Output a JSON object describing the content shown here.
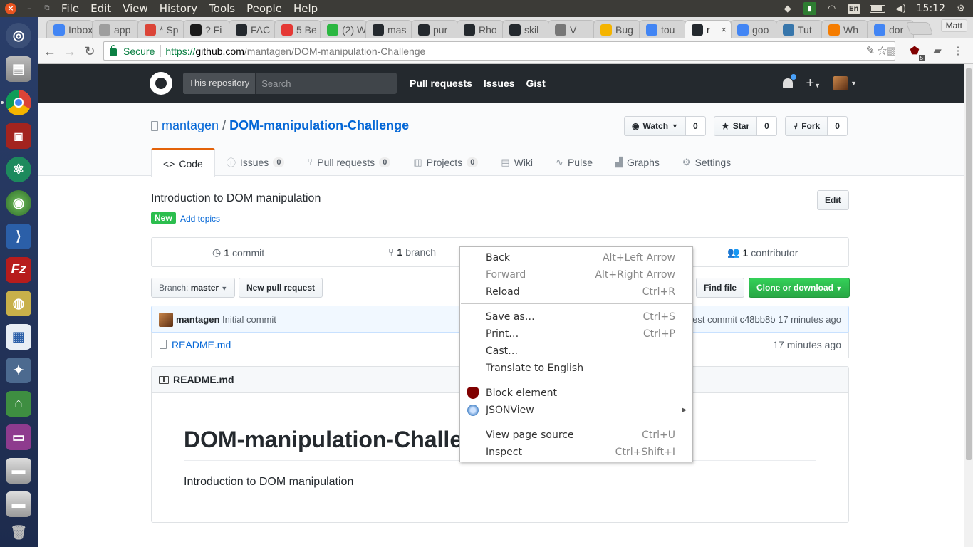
{
  "system": {
    "menus": [
      "File",
      "Edit",
      "View",
      "History",
      "Tools",
      "People",
      "Help"
    ],
    "keyboard_layout": "En",
    "clock": "15:12"
  },
  "browser": {
    "tabs": [
      {
        "title": "Inbox",
        "icon": "gmail-icon",
        "color": "#4285f4"
      },
      {
        "title": "app",
        "icon": "cloud-icon",
        "color": "#9e9e9e"
      },
      {
        "title": "* Sp",
        "icon": "sheets-icon",
        "color": "#db4437"
      },
      {
        "title": "? Fi",
        "icon": "glitch-icon",
        "color": "#1b1b1b"
      },
      {
        "title": "FAC",
        "icon": "github-icon",
        "color": "#24292e"
      },
      {
        "title": "5 Be",
        "icon": "bar-icon",
        "color": "#e53935"
      },
      {
        "title": "(2) W",
        "icon": "whatsapp-icon",
        "color": "#2bb741"
      },
      {
        "title": "mas",
        "icon": "github-icon",
        "color": "#24292e"
      },
      {
        "title": "pur",
        "icon": "github-icon",
        "color": "#24292e"
      },
      {
        "title": "Rho",
        "icon": "github-icon",
        "color": "#24292e"
      },
      {
        "title": "skil",
        "icon": "github-icon",
        "color": "#24292e"
      },
      {
        "title": "V",
        "icon": "page-icon",
        "color": "#777777"
      },
      {
        "title": "Bug",
        "icon": "lp-icon",
        "color": "#f4b400"
      },
      {
        "title": "tou",
        "icon": "google-icon",
        "color": "#4285f4"
      },
      {
        "title": "r",
        "icon": "github-icon",
        "color": "#24292e",
        "active": true
      },
      {
        "title": "goo",
        "icon": "google-icon",
        "color": "#4285f4"
      },
      {
        "title": "Tut",
        "icon": "python-icon",
        "color": "#3776ab"
      },
      {
        "title": "Wh",
        "icon": "asterisk-icon",
        "color": "#f57c00"
      },
      {
        "title": "dor",
        "icon": "google-icon",
        "color": "#4285f4"
      }
    ],
    "profile_name": "Matt",
    "security_label": "Secure",
    "url_scheme": "https://",
    "url_host": "github.com",
    "url_path": "/mantagen/DOM-manipulation-Challenge",
    "ublock_badge": "5"
  },
  "github": {
    "search_scope": "This repository",
    "search_placeholder": "Search",
    "nav": [
      "Pull requests",
      "Issues",
      "Gist"
    ],
    "owner": "mantagen",
    "repo": "DOM-manipulation-Challenge",
    "watch": {
      "label": "Watch",
      "count": "0"
    },
    "star": {
      "label": "Star",
      "count": "0"
    },
    "fork": {
      "label": "Fork",
      "count": "0"
    },
    "tabs": [
      {
        "label": "Code",
        "icon": "code-icon"
      },
      {
        "label": "Issues",
        "count": "0",
        "icon": "issue-icon"
      },
      {
        "label": "Pull requests",
        "count": "0",
        "icon": "pr-icon"
      },
      {
        "label": "Projects",
        "count": "0",
        "icon": "project-icon"
      },
      {
        "label": "Wiki",
        "icon": "wiki-icon"
      },
      {
        "label": "Pulse",
        "icon": "pulse-icon"
      },
      {
        "label": "Graphs",
        "icon": "graph-icon"
      },
      {
        "label": "Settings",
        "icon": "gear-icon"
      }
    ],
    "description": "Introduction to DOM manipulation",
    "edit_label": "Edit",
    "new_badge": "New",
    "add_topics": "Add topics",
    "summary": {
      "commits_num": "1",
      "commits_label": "commit",
      "branches_num": "1",
      "branches_label": "branch",
      "contributors_num": "1",
      "contributors_label": "contributor"
    },
    "branch_prefix": "Branch:",
    "branch_name": "master",
    "new_pr_label": "New pull request",
    "find_file_label": "Find file",
    "clone_label": "Clone or download",
    "commit": {
      "author": "mantagen",
      "message": "Initial commit",
      "latest_prefix": "est commit",
      "sha": "c48bb8b",
      "age": "17 minutes ago"
    },
    "files": [
      {
        "name": "README.md",
        "age": "17 minutes ago"
      }
    ],
    "readme": {
      "filename": "README.md",
      "heading": "DOM-manipulation-Challe",
      "body": "Introduction to DOM manipulation"
    }
  },
  "context_menu": {
    "items": [
      {
        "label": "Back",
        "shortcut": "Alt+Left Arrow"
      },
      {
        "label": "Forward",
        "shortcut": "Alt+Right Arrow",
        "disabled": true
      },
      {
        "label": "Reload",
        "shortcut": "Ctrl+R"
      },
      {
        "label": "Save as…",
        "shortcut": "Ctrl+S"
      },
      {
        "label": "Print…",
        "shortcut": "Ctrl+P"
      },
      {
        "label": "Cast…",
        "shortcut": ""
      },
      {
        "label": "Translate to English",
        "shortcut": ""
      },
      {
        "label": "Block element",
        "shortcut": "",
        "icon": "ublock-icon"
      },
      {
        "label": "JSONView",
        "shortcut": "",
        "icon": "jsonview-icon",
        "submenu": true
      },
      {
        "label": "View page source",
        "shortcut": "Ctrl+U"
      },
      {
        "label": "Inspect",
        "shortcut": "Ctrl+Shift+I"
      }
    ]
  }
}
